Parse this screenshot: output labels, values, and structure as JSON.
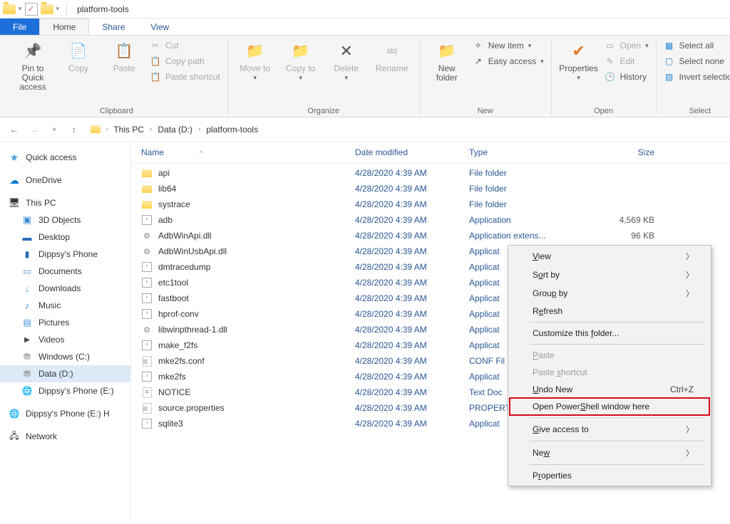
{
  "window": {
    "title": "platform-tools"
  },
  "tabs": {
    "file": "File",
    "home": "Home",
    "share": "Share",
    "view": "View"
  },
  "ribbon": {
    "clipboard": {
      "label": "Clipboard",
      "pin": "Pin to Quick access",
      "copy": "Copy",
      "paste": "Paste",
      "cut": "Cut",
      "copypath": "Copy path",
      "pasteshortcut": "Paste shortcut"
    },
    "organize": {
      "label": "Organize",
      "moveto": "Move to",
      "copyto": "Copy to",
      "delete": "Delete",
      "rename": "Rename"
    },
    "new": {
      "label": "New",
      "newfolder": "New folder",
      "newitem": "New item",
      "easyaccess": "Easy access"
    },
    "open": {
      "label": "Open",
      "properties": "Properties",
      "open": "Open",
      "edit": "Edit",
      "history": "History"
    },
    "select": {
      "label": "Select",
      "selectall": "Select all",
      "selectnone": "Select none",
      "invert": "Invert selection"
    }
  },
  "breadcrumb": {
    "pc": "This PC",
    "drive": "Data (D:)",
    "folder": "platform-tools"
  },
  "sidebar": {
    "quick": "Quick access",
    "onedrive": "OneDrive",
    "thispc": "This PC",
    "items": [
      "3D Objects",
      "Desktop",
      "Dippsy's Phone",
      "Documents",
      "Downloads",
      "Music",
      "Pictures",
      "Videos",
      "Windows (C:)",
      "Data (D:)",
      "Dippsy's Phone (E:)"
    ],
    "dippsyh": "Dippsy's Phone (E:) H",
    "network": "Network"
  },
  "columns": {
    "name": "Name",
    "date": "Date modified",
    "type": "Type",
    "size": "Size"
  },
  "files": [
    {
      "name": "api",
      "date": "4/28/2020 4:39 AM",
      "type": "File folder",
      "size": "",
      "icon": "folder"
    },
    {
      "name": "lib64",
      "date": "4/28/2020 4:39 AM",
      "type": "File folder",
      "size": "",
      "icon": "folder"
    },
    {
      "name": "systrace",
      "date": "4/28/2020 4:39 AM",
      "type": "File folder",
      "size": "",
      "icon": "folder"
    },
    {
      "name": "adb",
      "date": "4/28/2020 4:39 AM",
      "type": "Application",
      "size": "4,569 KB",
      "icon": "exe"
    },
    {
      "name": "AdbWinApi.dll",
      "date": "4/28/2020 4:39 AM",
      "type": "Application extens...",
      "size": "96 KB",
      "icon": "dll"
    },
    {
      "name": "AdbWinUsbApi.dll",
      "date": "4/28/2020 4:39 AM",
      "type": "Applicat",
      "size": "",
      "icon": "dll"
    },
    {
      "name": "dmtracedump",
      "date": "4/28/2020 4:39 AM",
      "type": "Applicat",
      "size": "",
      "icon": "exe"
    },
    {
      "name": "etc1tool",
      "date": "4/28/2020 4:39 AM",
      "type": "Applicat",
      "size": "",
      "icon": "exe"
    },
    {
      "name": "fastboot",
      "date": "4/28/2020 4:39 AM",
      "type": "Applicat",
      "size": "",
      "icon": "exe"
    },
    {
      "name": "hprof-conv",
      "date": "4/28/2020 4:39 AM",
      "type": "Applicat",
      "size": "",
      "icon": "exe"
    },
    {
      "name": "libwinpthread-1.dll",
      "date": "4/28/2020 4:39 AM",
      "type": "Applicat",
      "size": "",
      "icon": "dll"
    },
    {
      "name": "make_f2fs",
      "date": "4/28/2020 4:39 AM",
      "type": "Applicat",
      "size": "",
      "icon": "exe"
    },
    {
      "name": "mke2fs.conf",
      "date": "4/28/2020 4:39 AM",
      "type": "CONF Fil",
      "size": "",
      "icon": "conf"
    },
    {
      "name": "mke2fs",
      "date": "4/28/2020 4:39 AM",
      "type": "Applicat",
      "size": "",
      "icon": "exe"
    },
    {
      "name": "NOTICE",
      "date": "4/28/2020 4:39 AM",
      "type": "Text Doc",
      "size": "",
      "icon": "txt"
    },
    {
      "name": "source.properties",
      "date": "4/28/2020 4:39 AM",
      "type": "PROPERT",
      "size": "",
      "icon": "conf"
    },
    {
      "name": "sqlite3",
      "date": "4/28/2020 4:39 AM",
      "type": "Applicat",
      "size": "",
      "icon": "exe"
    }
  ],
  "ctx": {
    "view": "View",
    "sortby": "Sort by",
    "groupby": "Group by",
    "refresh": "Refresh",
    "customize": "Customize this folder...",
    "paste": "Paste",
    "pasteshortcut": "Paste shortcut",
    "undo": "Undo New",
    "undo_accel": "Ctrl+Z",
    "powershell": "Open PowerShell window here",
    "giveaccess": "Give access to",
    "new": "New",
    "props": "Properties"
  }
}
